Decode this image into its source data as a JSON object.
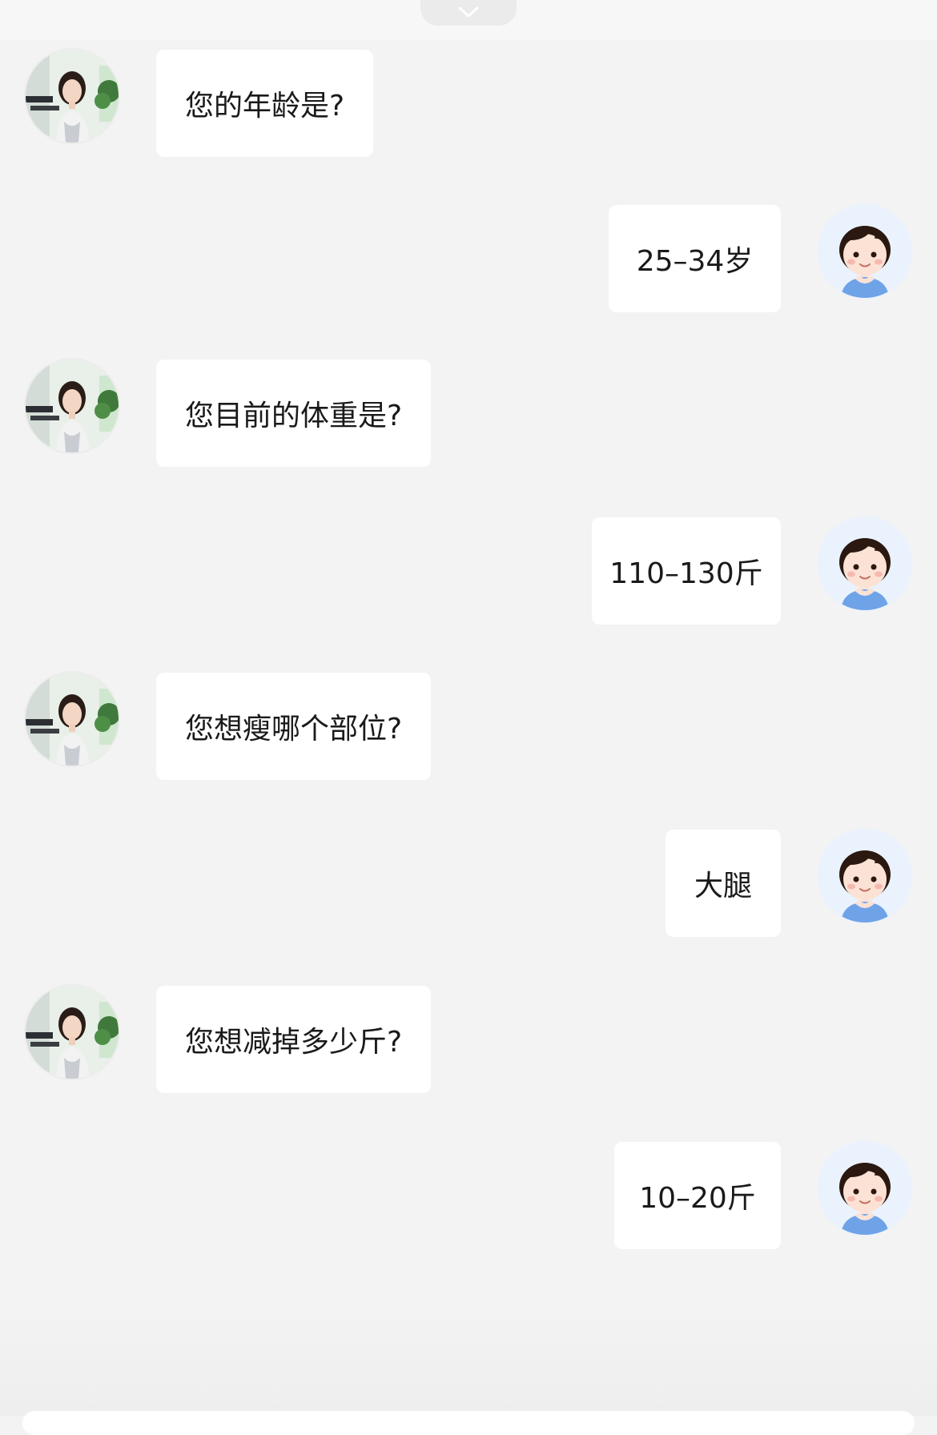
{
  "messages": [
    {
      "sender": "coach",
      "text": "您的年龄是?"
    },
    {
      "sender": "user",
      "text": "25–34岁"
    },
    {
      "sender": "coach",
      "text": "您目前的体重是?"
    },
    {
      "sender": "user",
      "text": "110–130斤"
    },
    {
      "sender": "coach",
      "text": "您想瘦哪个部位?"
    },
    {
      "sender": "user",
      "text": "大腿"
    },
    {
      "sender": "coach",
      "text": "您想减掉多少斤?"
    },
    {
      "sender": "user",
      "text": "10–20斤"
    }
  ],
  "icons": {
    "collapse": "chevron-down-icon",
    "coach_avatar": "coach-avatar-photo",
    "user_avatar": "cartoon-user-avatar"
  },
  "colors": {
    "background": "#f3f3f3",
    "bubble": "#ffffff",
    "text": "#1a1a1a",
    "user_shirt": "#6fa3e8"
  }
}
